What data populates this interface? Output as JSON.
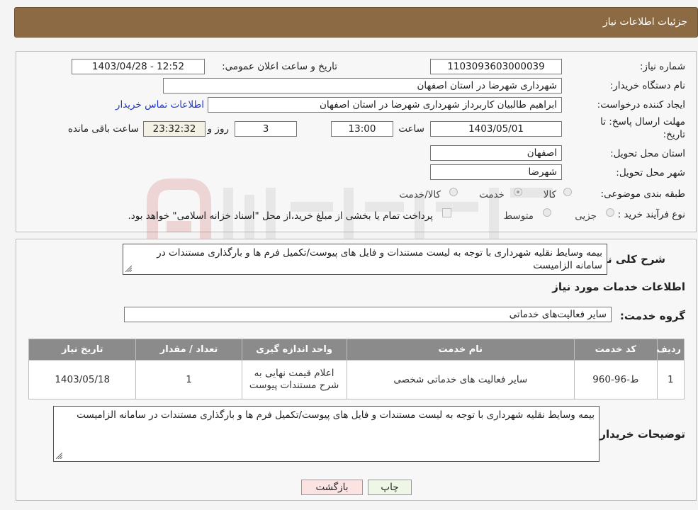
{
  "header": {
    "title": "جزئیات اطلاعات نیاز"
  },
  "details": {
    "need_number_label": "شماره نیاز:",
    "need_number": "1103093603000039",
    "announce_label": "تاریخ و ساعت اعلان عمومی:",
    "announce_value": "1403/04/28 - 12:52",
    "buyer_org_label": "نام دستگاه خریدار:",
    "buyer_org": "شهرداری شهرضا در استان اصفهان",
    "creator_label": "ایجاد کننده درخواست:",
    "creator": "ابراهیم طالبیان کاربرداز شهرداری شهرضا در استان اصفهان",
    "contact_link": "اطلاعات تماس خریدار",
    "deadline_label_1": "مهلت ارسال پاسخ: تا",
    "deadline_label_2": "تاریخ:",
    "deadline_date": "1403/05/01",
    "time_label": "ساعت",
    "deadline_time": "13:00",
    "days_value": "3",
    "days_label": "روز و",
    "remaining_time": "23:32:32",
    "remaining_label": "ساعت باقی مانده",
    "province_label": "استان محل تحویل:",
    "province": "اصفهان",
    "city_label": "شهر محل تحویل:",
    "city": "شهرضا",
    "category_label": "طبقه بندی موضوعی:",
    "category_options": [
      "کالا",
      "خدمت",
      "کالا/خدمت"
    ],
    "category_selected": "خدمت",
    "process_label": "نوع فرآیند خرید :",
    "process_options": [
      "جزیی",
      "متوسط"
    ],
    "payment_note": "پرداخت تمام یا بخشی از مبلغ خرید،از محل \"اسناد خزانه اسلامی\" خواهد بود."
  },
  "summary": {
    "label": "شرح کلی نیاز:",
    "text": "بیمه وسایط نقلیه شهرداری با توجه به لیست مستندات و فایل های پیوست/تکمیل فرم ها و بارگذاری مستندات در سامانه الزامیست",
    "services_title": "اطلاعات خدمات مورد نیاز",
    "group_label": "گروه خدمت:",
    "group_value": "سایر فعالیت‌های خدماتی"
  },
  "table": {
    "headers": [
      "ردیف",
      "کد خدمت",
      "نام خدمت",
      "واحد اندازه گیری",
      "تعداد / مقدار",
      "تاریخ نیاز"
    ],
    "rows": [
      [
        "1",
        "ط-96-960",
        "سایر فعالیت های خدماتی شخصی",
        "اعلام قیمت نهایی به شرح مستندات پیوست",
        "1",
        "1403/05/18"
      ]
    ]
  },
  "buyer_notes": {
    "label": "توضیحات خریدار:",
    "text": "بیمه وسایط نقلیه شهرداری با توجه به لیست مستندات و فایل های پیوست/تکمیل فرم ها و بارگذاری مستندات در سامانه الزامیست"
  },
  "buttons": {
    "print": "چاپ",
    "back": "بازگشت"
  },
  "colors": {
    "header": "#8b6a44",
    "table_header": "#8b8b8b",
    "print_button": "#eef7e6",
    "back_button": "#fbe3e3"
  }
}
